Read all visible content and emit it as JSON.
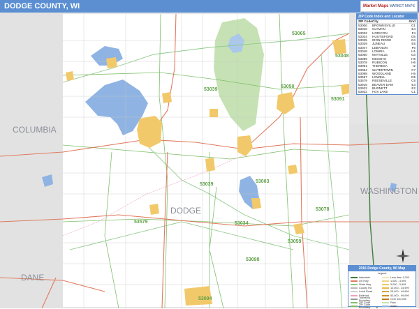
{
  "header": {
    "title": "DODGE COUNTY, WI",
    "logo_brand": "Market Maps",
    "logo_tag": "MARKET MAPS"
  },
  "map": {
    "county_labels": {
      "columbia": "COLUMBIA",
      "dane": "DANE",
      "washington": "WASHINGTON",
      "dodge": "DODGE"
    },
    "zip_labels": [
      "53065",
      "53048",
      "53050",
      "53091",
      "53039",
      "53039",
      "53003",
      "53078",
      "53579",
      "53034",
      "53059",
      "53098",
      "53094"
    ],
    "colors": {
      "water": "#8fb4e3",
      "park": "#c6e2b4",
      "urban": "#f2c96a",
      "county_outside": "#e5e5e5",
      "road_primary": "#e07a5f",
      "road_secondary": "#8fc98a",
      "road_minor": "#b8b8b8",
      "zip_boundary": "#7fbf6a"
    }
  },
  "locator": {
    "title": "ZIP Code Index and Locator",
    "headers": [
      "ZIP Code",
      "City",
      "Grid"
    ],
    "rows": [
      [
        "53006",
        "BROWNSVILLE",
        "G1"
      ],
      [
        "53010",
        "CLYMAN",
        "E4"
      ],
      [
        "53032",
        "HORICON",
        "F4"
      ],
      [
        "53034",
        "HUSTISFORD",
        "G5"
      ],
      [
        "53035",
        "IRON RIDGE",
        "G4"
      ],
      [
        "53039",
        "JUNEAU",
        "E5"
      ],
      [
        "53047",
        "LEBANON",
        "F6"
      ],
      [
        "53048",
        "LOMIRA",
        "H1"
      ],
      [
        "53050",
        "MAYVILLE",
        "G3"
      ],
      [
        "53059",
        "NEOSHO",
        "H6"
      ],
      [
        "53078",
        "RUBICON",
        "H6"
      ],
      [
        "53091",
        "THERESA",
        "I2"
      ],
      [
        "53094",
        "WATERTOWN",
        "C7"
      ],
      [
        "53098",
        "WOODLAND",
        "H5"
      ],
      [
        "53557",
        "LOWELL",
        "D5"
      ],
      [
        "53579",
        "REESEVILLE",
        "C6"
      ],
      [
        "53916",
        "BEAVER DAM",
        "E3"
      ],
      [
        "53922",
        "BURNETT",
        "E2"
      ],
      [
        "53932",
        "FOX LAKE",
        "C1"
      ]
    ]
  },
  "legend": {
    "title": "2016 Dodge County, WI Map",
    "subtitle": "Legend",
    "left": [
      "Interstate",
      "US Hwy",
      "State Hwy",
      "County Rd",
      "Local Road",
      "Railroad",
      "Township Boundary",
      "ZIP Code",
      "ZIP Code Boundary"
    ],
    "right": [
      "Less than 1,000",
      "1,000 - 4,999",
      "5,000 - 9,999",
      "10,000 - 24,999",
      "25,000 - 49,999",
      "50,000 - 99,999",
      "Over 100,000",
      "Park",
      "Water"
    ]
  }
}
